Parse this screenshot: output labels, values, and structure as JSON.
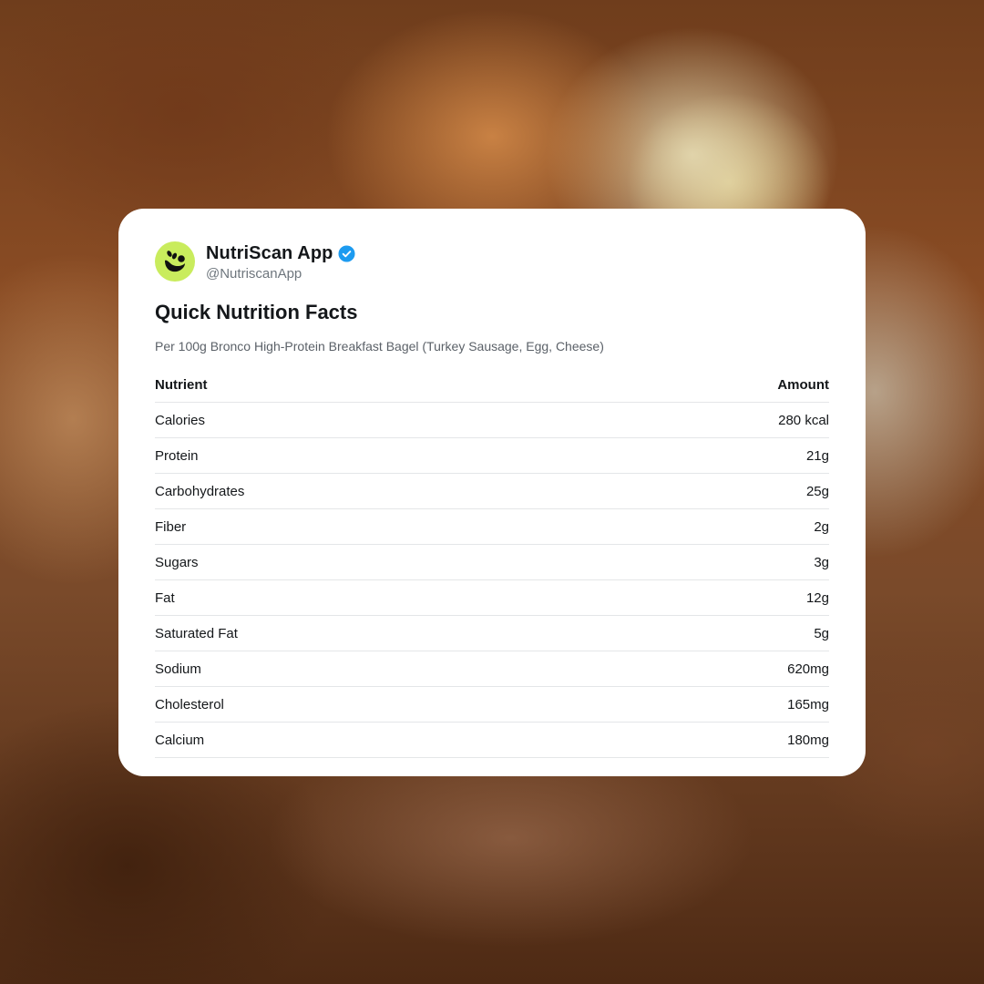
{
  "post": {
    "author_name": "NutriScan App",
    "handle": "@NutriscanApp",
    "verified_icon": "verified-badge-icon",
    "avatar_icon": "leaf-logo-icon"
  },
  "card": {
    "title": "Quick Nutrition Facts",
    "subtitle": "Per 100g Bronco High-Protein Breakfast Bagel (Turkey Sausage, Egg, Cheese)"
  },
  "table": {
    "headers": [
      "Nutrient",
      "Amount"
    ],
    "rows": [
      [
        "Calories",
        "280 kcal"
      ],
      [
        "Protein",
        "21g"
      ],
      [
        "Carbohydrates",
        "25g"
      ],
      [
        "Fiber",
        "2g"
      ],
      [
        "Sugars",
        "3g"
      ],
      [
        "Fat",
        "12g"
      ],
      [
        "Saturated Fat",
        "5g"
      ],
      [
        "Sodium",
        "620mg"
      ],
      [
        "Cholesterol",
        "165mg"
      ],
      [
        "Calcium",
        "180mg"
      ]
    ]
  },
  "colors": {
    "avatar_bg": "#c9ec5d",
    "verified": "#1d9bf0",
    "card_bg": "#ffffff",
    "text": "#14171a",
    "muted": "#6e767d"
  }
}
